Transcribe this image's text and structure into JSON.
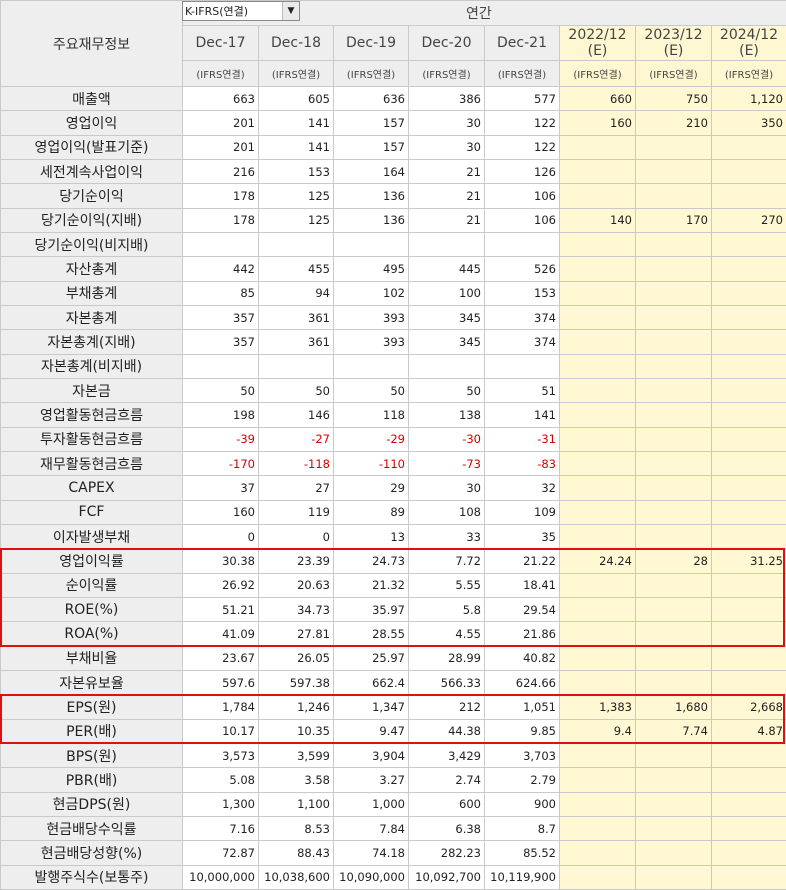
{
  "header": {
    "row_label_title": "주요재무정보",
    "accounting_select": "K-IFRS(연결)",
    "period_label": "연간",
    "columns": [
      {
        "year": "Dec-17",
        "basis": "(IFRS연결)",
        "estimate": false
      },
      {
        "year": "Dec-18",
        "basis": "(IFRS연결)",
        "estimate": false
      },
      {
        "year": "Dec-19",
        "basis": "(IFRS연결)",
        "estimate": false
      },
      {
        "year": "Dec-20",
        "basis": "(IFRS연결)",
        "estimate": false
      },
      {
        "year": "Dec-21",
        "basis": "(IFRS연결)",
        "estimate": false
      },
      {
        "year": "2022/12\n(E)",
        "basis": "(IFRS연결)",
        "estimate": true
      },
      {
        "year": "2023/12\n(E)",
        "basis": "(IFRS연결)",
        "estimate": true
      },
      {
        "year": "2024/12\n(E)",
        "basis": "(IFRS연결)",
        "estimate": true
      }
    ]
  },
  "rows": [
    {
      "label": "매출액",
      "values": [
        "663",
        "605",
        "636",
        "386",
        "577",
        "660",
        "750",
        "1,120"
      ]
    },
    {
      "label": "영업이익",
      "values": [
        "201",
        "141",
        "157",
        "30",
        "122",
        "160",
        "210",
        "350"
      ]
    },
    {
      "label": "영업이익(발표기준)",
      "values": [
        "201",
        "141",
        "157",
        "30",
        "122",
        "",
        "",
        ""
      ]
    },
    {
      "label": "세전계속사업이익",
      "values": [
        "216",
        "153",
        "164",
        "21",
        "126",
        "",
        "",
        ""
      ]
    },
    {
      "label": "당기순이익",
      "values": [
        "178",
        "125",
        "136",
        "21",
        "106",
        "",
        "",
        ""
      ]
    },
    {
      "label": "당기순이익(지배)",
      "values": [
        "178",
        "125",
        "136",
        "21",
        "106",
        "140",
        "170",
        "270"
      ]
    },
    {
      "label": "당기순이익(비지배)",
      "values": [
        "",
        "",
        "",
        "",
        "",
        "",
        "",
        ""
      ]
    },
    {
      "label": "자산총계",
      "values": [
        "442",
        "455",
        "495",
        "445",
        "526",
        "",
        "",
        ""
      ]
    },
    {
      "label": "부채총계",
      "values": [
        "85",
        "94",
        "102",
        "100",
        "153",
        "",
        "",
        ""
      ]
    },
    {
      "label": "자본총계",
      "values": [
        "357",
        "361",
        "393",
        "345",
        "374",
        "",
        "",
        ""
      ]
    },
    {
      "label": "자본총계(지배)",
      "values": [
        "357",
        "361",
        "393",
        "345",
        "374",
        "",
        "",
        ""
      ]
    },
    {
      "label": "자본총계(비지배)",
      "values": [
        "",
        "",
        "",
        "",
        "",
        "",
        "",
        ""
      ]
    },
    {
      "label": "자본금",
      "values": [
        "50",
        "50",
        "50",
        "50",
        "51",
        "",
        "",
        ""
      ]
    },
    {
      "label": "영업활동현금흐름",
      "values": [
        "198",
        "146",
        "118",
        "138",
        "141",
        "",
        "",
        ""
      ]
    },
    {
      "label": "투자활동현금흐름",
      "values": [
        "-39",
        "-27",
        "-29",
        "-30",
        "-31",
        "",
        "",
        ""
      ]
    },
    {
      "label": "재무활동현금흐름",
      "values": [
        "-170",
        "-118",
        "-110",
        "-73",
        "-83",
        "",
        "",
        ""
      ]
    },
    {
      "label": "CAPEX",
      "values": [
        "37",
        "27",
        "29",
        "30",
        "32",
        "",
        "",
        ""
      ]
    },
    {
      "label": "FCF",
      "values": [
        "160",
        "119",
        "89",
        "108",
        "109",
        "",
        "",
        ""
      ]
    },
    {
      "label": "이자발생부채",
      "values": [
        "0",
        "0",
        "13",
        "33",
        "35",
        "",
        "",
        ""
      ]
    },
    {
      "label": "영업이익률",
      "values": [
        "30.38",
        "23.39",
        "24.73",
        "7.72",
        "21.22",
        "24.24",
        "28",
        "31.25"
      ]
    },
    {
      "label": "순이익률",
      "values": [
        "26.92",
        "20.63",
        "21.32",
        "5.55",
        "18.41",
        "",
        "",
        ""
      ]
    },
    {
      "label": "ROE(%)",
      "values": [
        "51.21",
        "34.73",
        "35.97",
        "5.8",
        "29.54",
        "",
        "",
        ""
      ]
    },
    {
      "label": "ROA(%)",
      "values": [
        "41.09",
        "27.81",
        "28.55",
        "4.55",
        "21.86",
        "",
        "",
        ""
      ]
    },
    {
      "label": "부채비율",
      "values": [
        "23.67",
        "26.05",
        "25.97",
        "28.99",
        "40.82",
        "",
        "",
        ""
      ]
    },
    {
      "label": "자본유보율",
      "values": [
        "597.6",
        "597.38",
        "662.4",
        "566.33",
        "624.66",
        "",
        "",
        ""
      ]
    },
    {
      "label": "EPS(원)",
      "values": [
        "1,784",
        "1,246",
        "1,347",
        "212",
        "1,051",
        "1,383",
        "1,680",
        "2,668"
      ]
    },
    {
      "label": "PER(배)",
      "values": [
        "10.17",
        "10.35",
        "9.47",
        "44.38",
        "9.85",
        "9.4",
        "7.74",
        "4.87"
      ]
    },
    {
      "label": "BPS(원)",
      "values": [
        "3,573",
        "3,599",
        "3,904",
        "3,429",
        "3,703",
        "",
        "",
        ""
      ]
    },
    {
      "label": "PBR(배)",
      "values": [
        "5.08",
        "3.58",
        "3.27",
        "2.74",
        "2.79",
        "",
        "",
        ""
      ]
    },
    {
      "label": "현금DPS(원)",
      "values": [
        "1,300",
        "1,100",
        "1,000",
        "600",
        "900",
        "",
        "",
        ""
      ]
    },
    {
      "label": "현금배당수익률",
      "values": [
        "7.16",
        "8.53",
        "7.84",
        "6.38",
        "8.7",
        "",
        "",
        ""
      ]
    },
    {
      "label": "현금배당성향(%)",
      "values": [
        "72.87",
        "88.43",
        "74.18",
        "282.23",
        "85.52",
        "",
        "",
        ""
      ]
    },
    {
      "label": "발행주식수(보통주)",
      "values": [
        "10,000,000",
        "10,038,600",
        "10,090,000",
        "10,092,700",
        "10,119,900",
        "",
        "",
        ""
      ]
    }
  ],
  "highlights": [
    {
      "from_row": 19,
      "to_row": 22,
      "color": "#e01010"
    },
    {
      "from_row": 25,
      "to_row": 26,
      "color": "#e01010"
    }
  ],
  "colors": {
    "header_bg": "#eeeeee",
    "estimate_bg": "#fff8d3",
    "negative": "#d40000",
    "highlight": "#e01010"
  }
}
